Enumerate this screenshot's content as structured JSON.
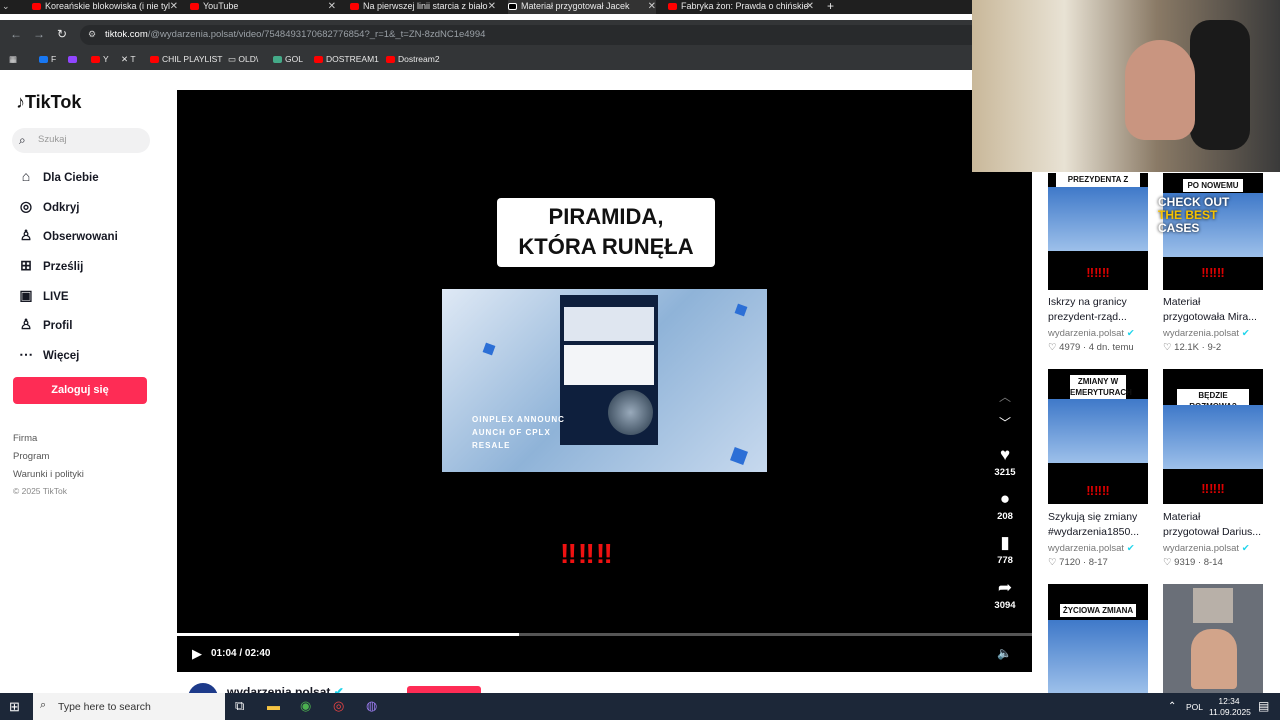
{
  "browser": {
    "tabs": [
      {
        "title": "Koreańskie blokowiska (i nie tyl",
        "icon": "youtube-icon"
      },
      {
        "title": "YouTube",
        "icon": "youtube-icon"
      },
      {
        "title": "Na pierwszej linii starcia z biało",
        "icon": "youtube-icon"
      },
      {
        "title": "Materiał przygotował Jacek",
        "icon": "tiktok-icon",
        "active": true
      },
      {
        "title": "Fabryka żon: Prawda o chińskie",
        "icon": "youtube-icon"
      }
    ],
    "url_host": "tiktok.com",
    "url_rest": "/@wydarzenia.polsat/video/7548493170682776854?_r=1&_t=ZN-8zdNC1e4994",
    "bookmarks": [
      "F",
      "",
      "Y",
      "T",
      "CHIL PLAYLIST",
      "OLD\\",
      "GOL",
      "DOSTREAM1",
      "Dostream2"
    ]
  },
  "sidebar": {
    "logo": "TikTok",
    "search_placeholder": "Szukaj",
    "items": [
      {
        "label": "Dla Ciebie",
        "icon": "home-icon"
      },
      {
        "label": "Odkryj",
        "icon": "compass-icon"
      },
      {
        "label": "Obserwowani",
        "icon": "following-icon"
      },
      {
        "label": "Prześlij",
        "icon": "upload-icon"
      },
      {
        "label": "LIVE",
        "icon": "live-icon"
      },
      {
        "label": "Profil",
        "icon": "profile-icon"
      },
      {
        "label": "Więcej",
        "icon": "more-icon"
      }
    ],
    "login_button": "Zaloguj się",
    "footer": [
      "Firma",
      "Program",
      "Warunki i polityki",
      "© 2025 TikTok"
    ]
  },
  "video": {
    "caption_line1": "PIRAMIDA,",
    "caption_line2": "KTÓRA RUNĘŁA",
    "frame_overlay_line1": "OINPLEX ANNOUNC",
    "frame_overlay_line2": "AUNCH OF CPLX",
    "frame_overlay_line3": "RESALE",
    "exclaim": "‼‼‼",
    "likes": "3215",
    "comments": "208",
    "saves": "778",
    "shares": "3094",
    "time": "01:04 / 02:40",
    "progress": 0.4,
    "author": "wydarzenia.polsat"
  },
  "related": [
    {
      "tag": "PREZYDENTA Z RZĄDEM",
      "title_line1": "Iskrzy na granicy",
      "title_line2": "prezydent-rząd...",
      "author": "wydarzenia.polsat",
      "likes": "4979",
      "date": "4 dn. temu",
      "exclaim": "‼‼‼"
    },
    {
      "tag": "PO NOWEMU",
      "title_line1": "Materiał",
      "title_line2": "przygotowała Mira...",
      "author": "wydarzenia.polsat",
      "likes": "12.1K",
      "date": "9-2",
      "exclaim": "‼‼‼"
    },
    {
      "tag": "ZMIANY W EMERYTURACH",
      "title_line1": "Szykują się zmiany",
      "title_line2": "#wydarzenia1850...",
      "author": "wydarzenia.polsat",
      "likes": "7120",
      "date": "8-17",
      "exclaim": "‼‼‼"
    },
    {
      "tag": "BĘDZIE ROZMOWA?",
      "title_line1": "Materiał",
      "title_line2": "przygotował Darius...",
      "author": "wydarzenia.polsat",
      "likes": "9319",
      "date": "8-14",
      "exclaim": "‼‼‼"
    },
    {
      "tag": "ŻYCIOWA ZMIANA",
      "title_line1": "",
      "title_line2": "",
      "author": "",
      "likes": "",
      "date": "",
      "exclaim": ""
    },
    {
      "tag": "",
      "title_line1": "",
      "title_line2": "",
      "author": "",
      "likes": "",
      "date": "",
      "exclaim": ""
    }
  ],
  "overlay_ad": {
    "line1": "CHECK OUT",
    "line2": "THE BEST",
    "line3": "CASES"
  },
  "taskbar": {
    "search_placeholder": "Type here to search",
    "lang": "POL",
    "time": "12:34",
    "date": "11.09.2025"
  }
}
